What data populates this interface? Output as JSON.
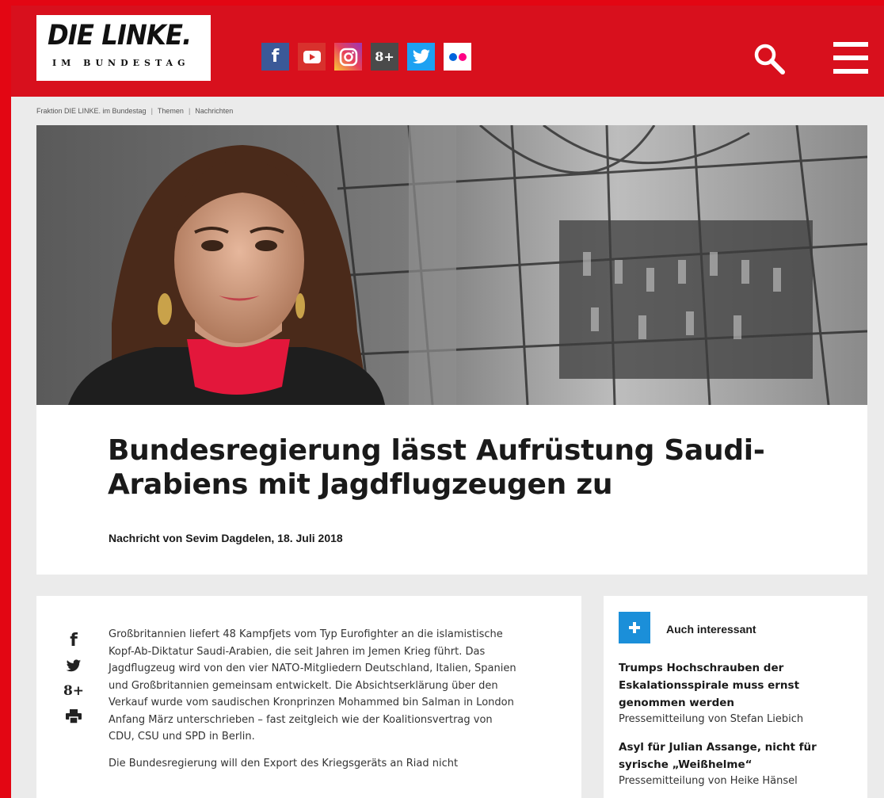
{
  "header": {
    "logo_main": "DIE LINKE.",
    "logo_sub": "IM BUNDESTAG",
    "social_icons": [
      "facebook-icon",
      "youtube-icon",
      "instagram-icon",
      "google-plus-icon",
      "twitter-icon",
      "flickr-icon"
    ],
    "gplus_label": "8+",
    "fb_label": "f",
    "brand_color": "#d8101d"
  },
  "breadcrumb": [
    "Fraktion DIE LINKE. im Bundestag",
    "Themen",
    "Nachrichten"
  ],
  "article": {
    "headline": "Bundesregierung lässt Aufrüstung Saudi-Arabiens mit Jagdflugzeugen zu",
    "byline": "Nachricht von Sevim Dagdelen, 18. Juli 2018",
    "paragraphs": [
      "Großbritannien liefert 48 Kampfjets vom Typ Eurofighter an die islamistische Kopf-Ab-Diktatur Saudi-Arabien, die seit Jahren im Jemen Krieg führt. Das Jagdflugzeug wird von den vier NATO-Mitgliedern Deutschland, Italien, Spanien und Großbritannien gemeinsam entwickelt. Die Absichtserklärung über den Verkauf wurde vom saudischen Kronprinzen Mohammed bin Salman in London Anfang März unterschrieben – fast zeitgleich wie der Koalitionsvertrag von CDU, CSU und SPD in Berlin.",
      "Die Bundesregierung will den Export des Kriegsgeräts an Riad nicht"
    ],
    "share": [
      "f",
      "8+"
    ]
  },
  "sidebar": {
    "heading": "Auch interessant",
    "items": [
      {
        "title": "Trumps Hochschrauben der Eskalationsspirale muss ernst genommen werden",
        "sub": "Pressemitteilung von Stefan Liebich"
      },
      {
        "title": "Asyl für Julian Assange, nicht für syrische „Weißhelme“",
        "sub": "Pressemitteilung von Heike Hänsel"
      }
    ]
  }
}
